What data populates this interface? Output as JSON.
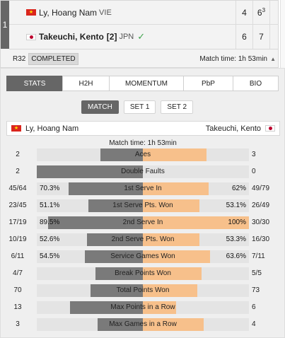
{
  "round_number": "1",
  "players": [
    {
      "name": "Ly, Hoang Nam",
      "seed": "",
      "country": "VIE",
      "winner": false,
      "sets": [
        "4",
        "6"
      ],
      "tiebreak": [
        "",
        "3"
      ]
    },
    {
      "name": "Takeuchi, Kento",
      "seed": "[2]",
      "country": "JPN",
      "winner": true,
      "sets": [
        "6",
        "7"
      ],
      "tiebreak": [
        "",
        ""
      ]
    }
  ],
  "winner_check": "✓",
  "status": {
    "round": "R32",
    "state": "COMPLETED",
    "match_time": "Match time: 1h 53min",
    "caret": "▲"
  },
  "tabs": [
    "STATS",
    "H2H",
    "MOMENTUM",
    "PbP",
    "BIO"
  ],
  "active_tab": "STATS",
  "subtabs": [
    "MATCH",
    "SET 1",
    "SET 2"
  ],
  "active_subtab": "MATCH",
  "stat_players": {
    "left": "Ly, Hoang Nam",
    "right": "Takeuchi, Kento"
  },
  "match_time_label": "Match time: 1h 53min",
  "stats": [
    {
      "label": "Aces",
      "left": "2",
      "right": "3",
      "left_pct": "",
      "right_pct": "",
      "left_ratio": 0.4,
      "right_ratio": 0.6
    },
    {
      "label": "Double Faults",
      "left": "2",
      "right": "0",
      "left_pct": "",
      "right_pct": "",
      "left_ratio": 1.0,
      "right_ratio": 0.0
    },
    {
      "label": "1st Serve In",
      "left": "45/64",
      "right": "49/79",
      "left_pct": "70.3%",
      "right_pct": "62%",
      "left_ratio": 0.703,
      "right_ratio": 0.62
    },
    {
      "label": "1st Serve Pts. Won",
      "left": "23/45",
      "right": "26/49",
      "left_pct": "51.1%",
      "right_pct": "53.1%",
      "left_ratio": 0.511,
      "right_ratio": 0.531
    },
    {
      "label": "2nd Serve In",
      "left": "17/19",
      "right": "30/30",
      "left_pct": "89.5%",
      "right_pct": "100%",
      "left_ratio": 0.895,
      "right_ratio": 1.0
    },
    {
      "label": "2nd Serve Pts. Won",
      "left": "10/19",
      "right": "16/30",
      "left_pct": "52.6%",
      "right_pct": "53.3%",
      "left_ratio": 0.526,
      "right_ratio": 0.533
    },
    {
      "label": "Service Games Won",
      "left": "6/11",
      "right": "7/11",
      "left_pct": "54.5%",
      "right_pct": "63.6%",
      "left_ratio": 0.545,
      "right_ratio": 0.636
    },
    {
      "label": "Break Points Won",
      "left": "4/7",
      "right": "5/5",
      "left_pct": "",
      "right_pct": "",
      "left_ratio": 0.444,
      "right_ratio": 0.556
    },
    {
      "label": "Total Points Won",
      "left": "70",
      "right": "73",
      "left_pct": "",
      "right_pct": "",
      "left_ratio": 0.49,
      "right_ratio": 0.51
    },
    {
      "label": "Max Points in a Row",
      "left": "13",
      "right": "6",
      "left_pct": "",
      "right_pct": "",
      "left_ratio": 0.684,
      "right_ratio": 0.316
    },
    {
      "label": "Max Games in a Row",
      "left": "3",
      "right": "4",
      "left_pct": "",
      "right_pct": "",
      "left_ratio": 0.429,
      "right_ratio": 0.571
    }
  ],
  "colors": {
    "left_bar": "#7a7a7a",
    "right_bar": "#f7c08b",
    "track": "#e4e4e4",
    "active_tab": "#666666",
    "winner_check": "#3fa34d"
  }
}
